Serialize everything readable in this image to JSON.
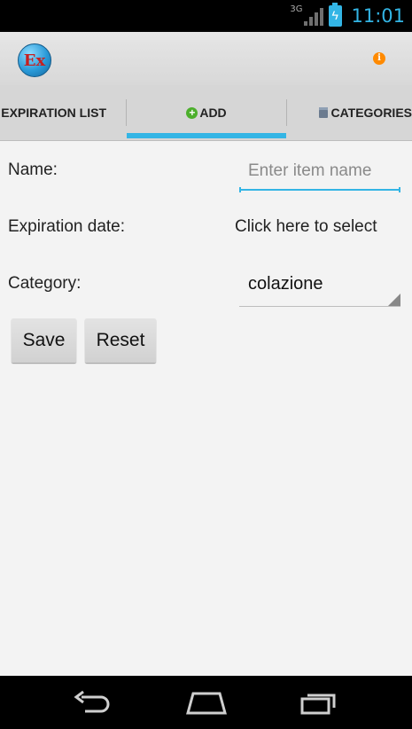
{
  "statusbar": {
    "network": "3G",
    "time": "11:01"
  },
  "actionbar": {
    "logo_text": "Ex"
  },
  "tabs": [
    {
      "label": "EXPIRATION LIST",
      "icon": null,
      "selected": false
    },
    {
      "label": "ADD",
      "icon": "plus-circle-icon",
      "selected": true
    },
    {
      "label": "CATEGORIES",
      "icon": "list-icon",
      "selected": false
    }
  ],
  "form": {
    "name_label": "Name:",
    "name_placeholder": "Enter item name",
    "name_value": "",
    "expiration_label": "Expiration date:",
    "expiration_value": "Click here to select",
    "category_label": "Category:",
    "category_value": "colazione"
  },
  "buttons": {
    "save": "Save",
    "reset": "Reset"
  },
  "colors": {
    "accent": "#33b5e5",
    "info": "#ff8a00",
    "plus": "#4caf2c"
  }
}
